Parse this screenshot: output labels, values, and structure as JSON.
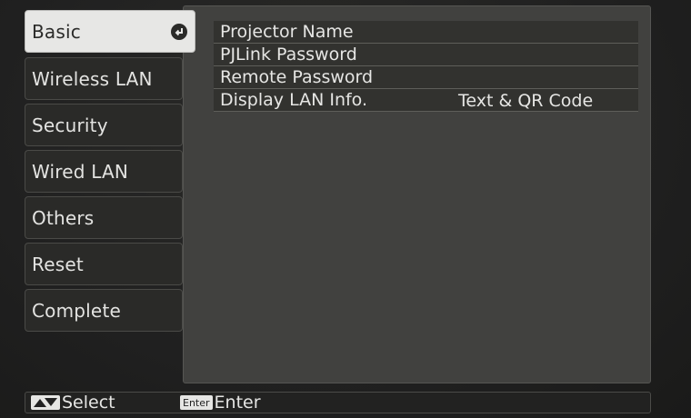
{
  "sidebar": {
    "items": [
      {
        "label": "Basic",
        "active": true
      },
      {
        "label": "Wireless LAN"
      },
      {
        "label": "Security"
      },
      {
        "label": "Wired LAN"
      },
      {
        "label": "Others"
      },
      {
        "label": "Reset"
      },
      {
        "label": "Complete"
      }
    ]
  },
  "main": {
    "rows": [
      {
        "label": "Projector Name",
        "value": ""
      },
      {
        "label": "PJLink Password",
        "value": ""
      },
      {
        "label": "Remote Password",
        "value": ""
      },
      {
        "label": "Display LAN Info.",
        "value": "Text & QR Code"
      }
    ]
  },
  "footer": {
    "select_label": "Select",
    "enter_key": "Enter",
    "enter_label": "Enter"
  },
  "icons": {
    "active_tab_marker": "enter-arrow-icon",
    "select_key": "up-down-arrows-icon"
  },
  "colors": {
    "active_tab_bg": "#e7e7e5",
    "panel_bg": "#41413f",
    "row_bg": "#32322f"
  }
}
